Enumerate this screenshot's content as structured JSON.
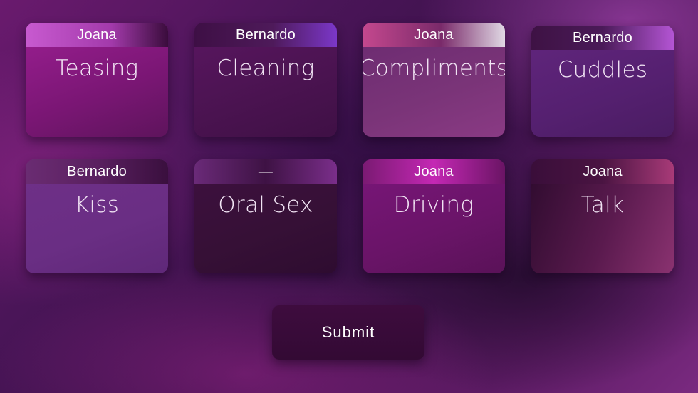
{
  "cards": [
    {
      "owner": "Joana",
      "title": "Teasing"
    },
    {
      "owner": "Bernardo",
      "title": "Cleaning"
    },
    {
      "owner": "Joana",
      "title": "Compliments"
    },
    {
      "owner": "Bernardo",
      "title": "Cuddles"
    },
    {
      "owner": "Bernardo",
      "title": "Kiss"
    },
    {
      "owner": "—",
      "title": "Oral Sex"
    },
    {
      "owner": "Joana",
      "title": "Driving"
    },
    {
      "owner": "Joana",
      "title": "Talk"
    }
  ],
  "submit": {
    "label": "Submit"
  }
}
